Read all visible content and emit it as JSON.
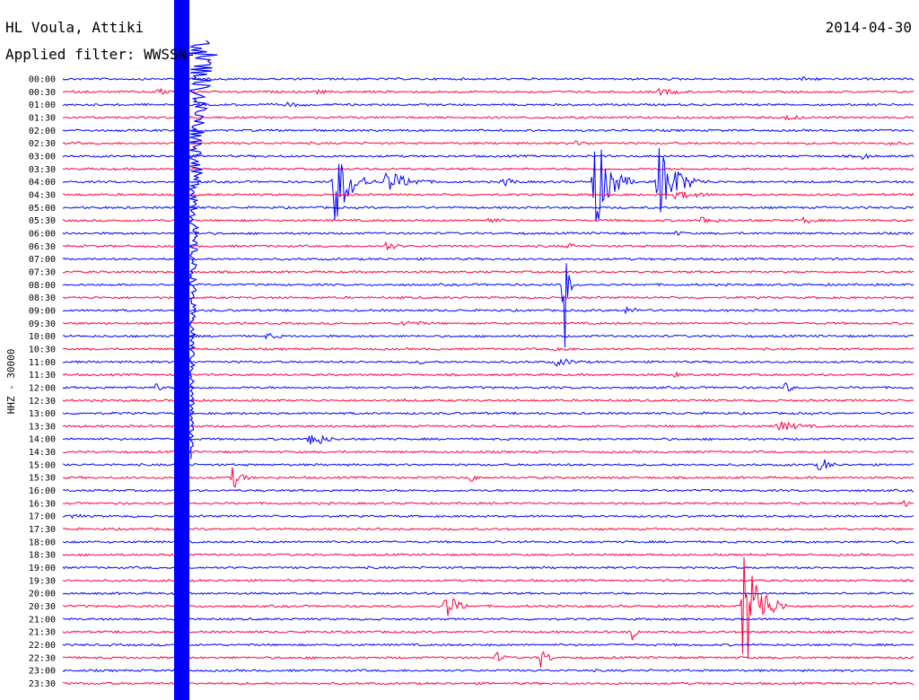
{
  "header": {
    "station": "HL Voula, Attiki",
    "date": "2014-04-30",
    "filter": "Applied filter: WWSSN-"
  },
  "channel_label": "HHZ - 30000",
  "colors": {
    "trace_a": "#0000ff",
    "trace_b": "#ff0040",
    "text": "#000000",
    "background": "#ffffff"
  },
  "chart_data": {
    "type": "line",
    "title": "HL Voula, Attiki",
    "subtitle": "Applied filter: WWSSN-",
    "ylabel": "HHZ - 30000",
    "xlabel": "",
    "row_labels": [
      "00:00",
      "00:30",
      "01:00",
      "01:30",
      "02:00",
      "02:30",
      "03:00",
      "03:30",
      "04:00",
      "04:30",
      "05:00",
      "05:30",
      "06:00",
      "06:30",
      "07:00",
      "07:30",
      "08:00",
      "08:30",
      "09:00",
      "09:30",
      "10:00",
      "10:30",
      "11:00",
      "11:30",
      "12:00",
      "12:30",
      "13:00",
      "13:30",
      "14:00",
      "14:30",
      "15:00",
      "15:30",
      "16:00",
      "16:30",
      "17:00",
      "17:30",
      "18:00",
      "18:30",
      "19:00",
      "19:30",
      "20:00",
      "20:30",
      "21:00",
      "21:30",
      "22:00",
      "22:30",
      "23:00",
      "23:30"
    ],
    "row_minutes": 30,
    "row_color_cycle": [
      "#0000ff",
      "#ff0040"
    ],
    "saturated_band": {
      "start_fraction": 0.145,
      "end_fraction": 0.173
    },
    "events": [
      {
        "row": 0,
        "at": 0.87,
        "amp": 3,
        "dur": 0.09
      },
      {
        "row": 1,
        "at": 0.11,
        "amp": 4,
        "dur": 0.1
      },
      {
        "row": 1,
        "at": 0.3,
        "amp": 3,
        "dur": 0.05
      },
      {
        "row": 1,
        "at": 0.7,
        "amp": 4,
        "dur": 0.1
      },
      {
        "row": 2,
        "at": 0.26,
        "amp": 3,
        "dur": 0.12
      },
      {
        "row": 3,
        "at": 0.85,
        "amp": 3,
        "dur": 0.1
      },
      {
        "row": 5,
        "at": 0.6,
        "amp": 3,
        "dur": 0.1
      },
      {
        "row": 5,
        "at": 0.97,
        "amp": 3,
        "dur": 0.06
      },
      {
        "row": 6,
        "at": 0.94,
        "amp": 4,
        "dur": 0.04
      },
      {
        "row": 8,
        "at": 0.32,
        "amp": 50,
        "dur": 0.05
      },
      {
        "row": 8,
        "at": 0.38,
        "amp": 14,
        "dur": 0.08
      },
      {
        "row": 8,
        "at": 0.52,
        "amp": 8,
        "dur": 0.03
      },
      {
        "row": 8,
        "at": 0.625,
        "amp": 60,
        "dur": 0.05
      },
      {
        "row": 8,
        "at": 0.7,
        "amp": 45,
        "dur": 0.06
      },
      {
        "row": 9,
        "at": 0.72,
        "amp": 5,
        "dur": 0.12
      },
      {
        "row": 11,
        "at": 0.5,
        "amp": 4,
        "dur": 0.06
      },
      {
        "row": 11,
        "at": 0.75,
        "amp": 5,
        "dur": 0.07
      },
      {
        "row": 11,
        "at": 0.87,
        "amp": 4,
        "dur": 0.06
      },
      {
        "row": 12,
        "at": 0.72,
        "amp": 3,
        "dur": 0.05
      },
      {
        "row": 13,
        "at": 0.38,
        "amp": 6,
        "dur": 0.04
      },
      {
        "row": 13,
        "at": 0.595,
        "amp": 6,
        "dur": 0.02
      },
      {
        "row": 16,
        "at": 0.59,
        "amp": 80,
        "dur": 0.01
      },
      {
        "row": 18,
        "at": 0.66,
        "amp": 4,
        "dur": 0.08
      },
      {
        "row": 19,
        "at": 0.4,
        "amp": 4,
        "dur": 0.08
      },
      {
        "row": 20,
        "at": 0.24,
        "amp": 4,
        "dur": 0.06
      },
      {
        "row": 21,
        "at": 0.58,
        "amp": 4,
        "dur": 0.06
      },
      {
        "row": 22,
        "at": 0.58,
        "amp": 5,
        "dur": 0.08
      },
      {
        "row": 22,
        "at": 0.42,
        "amp": 4,
        "dur": 0.02
      },
      {
        "row": 23,
        "at": 0.72,
        "amp": 4,
        "dur": 0.02
      },
      {
        "row": 24,
        "at": 0.11,
        "amp": 6,
        "dur": 0.02
      },
      {
        "row": 24,
        "at": 0.85,
        "amp": 8,
        "dur": 0.02
      },
      {
        "row": 25,
        "at": 0.4,
        "amp": 3,
        "dur": 0.02
      },
      {
        "row": 27,
        "at": 0.84,
        "amp": 6,
        "dur": 0.1
      },
      {
        "row": 28,
        "at": 0.29,
        "amp": 12,
        "dur": 0.05
      },
      {
        "row": 30,
        "at": 0.89,
        "amp": 12,
        "dur": 0.03
      },
      {
        "row": 31,
        "at": 0.2,
        "amp": 14,
        "dur": 0.03
      },
      {
        "row": 31,
        "at": 0.48,
        "amp": 6,
        "dur": 0.02
      },
      {
        "row": 33,
        "at": 0.99,
        "amp": 5,
        "dur": 0.02
      },
      {
        "row": 34,
        "at": 0.01,
        "amp": 4,
        "dur": 0.05
      },
      {
        "row": 41,
        "at": 0.45,
        "amp": 18,
        "dur": 0.04
      },
      {
        "row": 41,
        "at": 0.8,
        "amp": 85,
        "dur": 0.05
      },
      {
        "row": 43,
        "at": 0.67,
        "amp": 18,
        "dur": 0.01
      },
      {
        "row": 45,
        "at": 0.51,
        "amp": 7,
        "dur": 0.03
      },
      {
        "row": 45,
        "at": 0.56,
        "amp": 14,
        "dur": 0.03
      }
    ]
  }
}
